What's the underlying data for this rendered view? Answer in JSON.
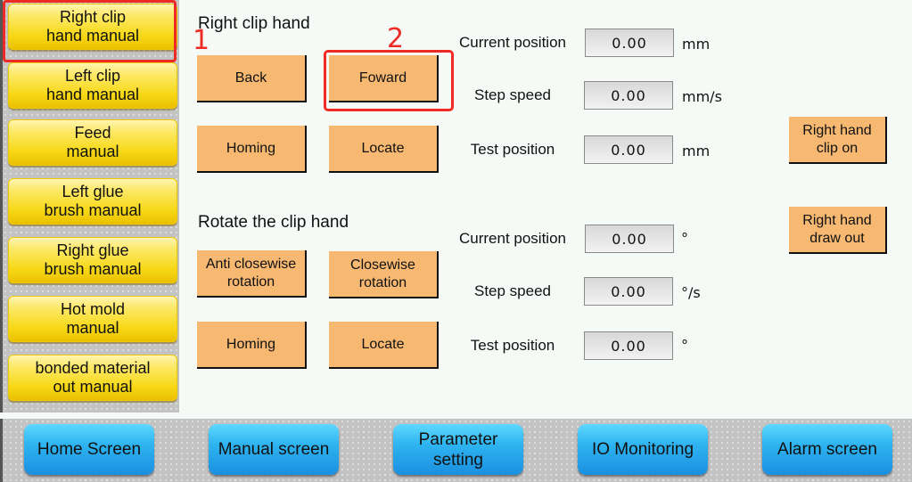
{
  "sidebar": {
    "items": [
      {
        "label": "Right clip\nhand manual",
        "selected": true
      },
      {
        "label": "Left clip\nhand manual"
      },
      {
        "label": "Feed\nmanual"
      },
      {
        "label": "Left glue\nbrush manual"
      },
      {
        "label": "Right glue\nbrush manual"
      },
      {
        "label": "Hot mold\nmanual"
      },
      {
        "label": "bonded material\nout manual"
      }
    ]
  },
  "annotations": {
    "one": "1",
    "two": "2",
    "color": "#ee2a24"
  },
  "clip_hand": {
    "title": "Right clip hand",
    "buttons": {
      "back": "Back",
      "forward": "Foward",
      "homing": "Homing",
      "locate": "Locate"
    },
    "fields": [
      {
        "label": "Current position",
        "value": "0.00",
        "unit": "mm"
      },
      {
        "label": "Step speed",
        "value": "0.00",
        "unit": "mm/s"
      },
      {
        "label": "Test position",
        "value": "0.00",
        "unit": "mm"
      }
    ]
  },
  "rotate": {
    "title": "Rotate the clip hand",
    "buttons": {
      "anti": "Anti closewise\nrotation",
      "clockwise": "Closewise\nrotation",
      "homing": "Homing",
      "locate": "Locate"
    },
    "fields": [
      {
        "label": "Current position",
        "value": "0.00",
        "unit": "°"
      },
      {
        "label": "Step speed",
        "value": "0.00",
        "unit": "°/s"
      },
      {
        "label": "Test position",
        "value": "0.00",
        "unit": "°"
      }
    ]
  },
  "side_actions": {
    "clip_on": "Right hand\nclip on",
    "draw_out": "Right hand\ndraw out"
  },
  "nav": [
    {
      "label": "Home Screen"
    },
    {
      "label": "Manual screen"
    },
    {
      "label": "Parameter\nsetting"
    },
    {
      "label": "IO Monitoring"
    },
    {
      "label": "Alarm screen"
    }
  ],
  "colors": {
    "orange_button": "#f7b872",
    "nav_blue": "#2eb4f0",
    "sidebar_yellow": "#f7d815"
  }
}
